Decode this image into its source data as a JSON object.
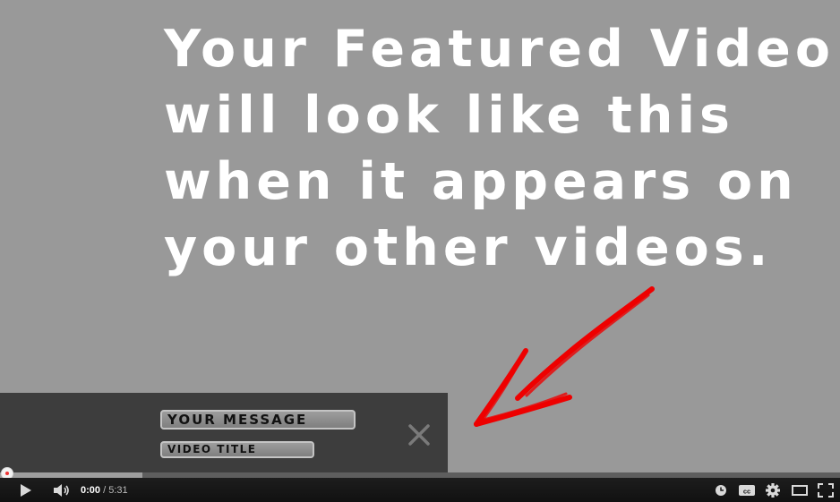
{
  "headline": {
    "lines": [
      "Your Featured Video",
      "will look like this",
      "when it appears on",
      "your other videos."
    ]
  },
  "featured_overlay": {
    "message": "YOUR MESSAGE",
    "video_title": "VIDEO TITLE"
  },
  "player": {
    "current_time": "0:00",
    "separator": " / ",
    "duration": "5:31",
    "buffered_fraction": 0.17,
    "icons": [
      "play-icon",
      "volume-icon",
      "watch-later-icon",
      "captions-icon",
      "settings-icon",
      "theater-mode-icon",
      "fullscreen-icon",
      "close-icon"
    ]
  },
  "colors": {
    "background": "#999999",
    "overlay": "#3d3d3d",
    "arrow": "#ee0000",
    "controlbar": "#1b1b1b"
  }
}
